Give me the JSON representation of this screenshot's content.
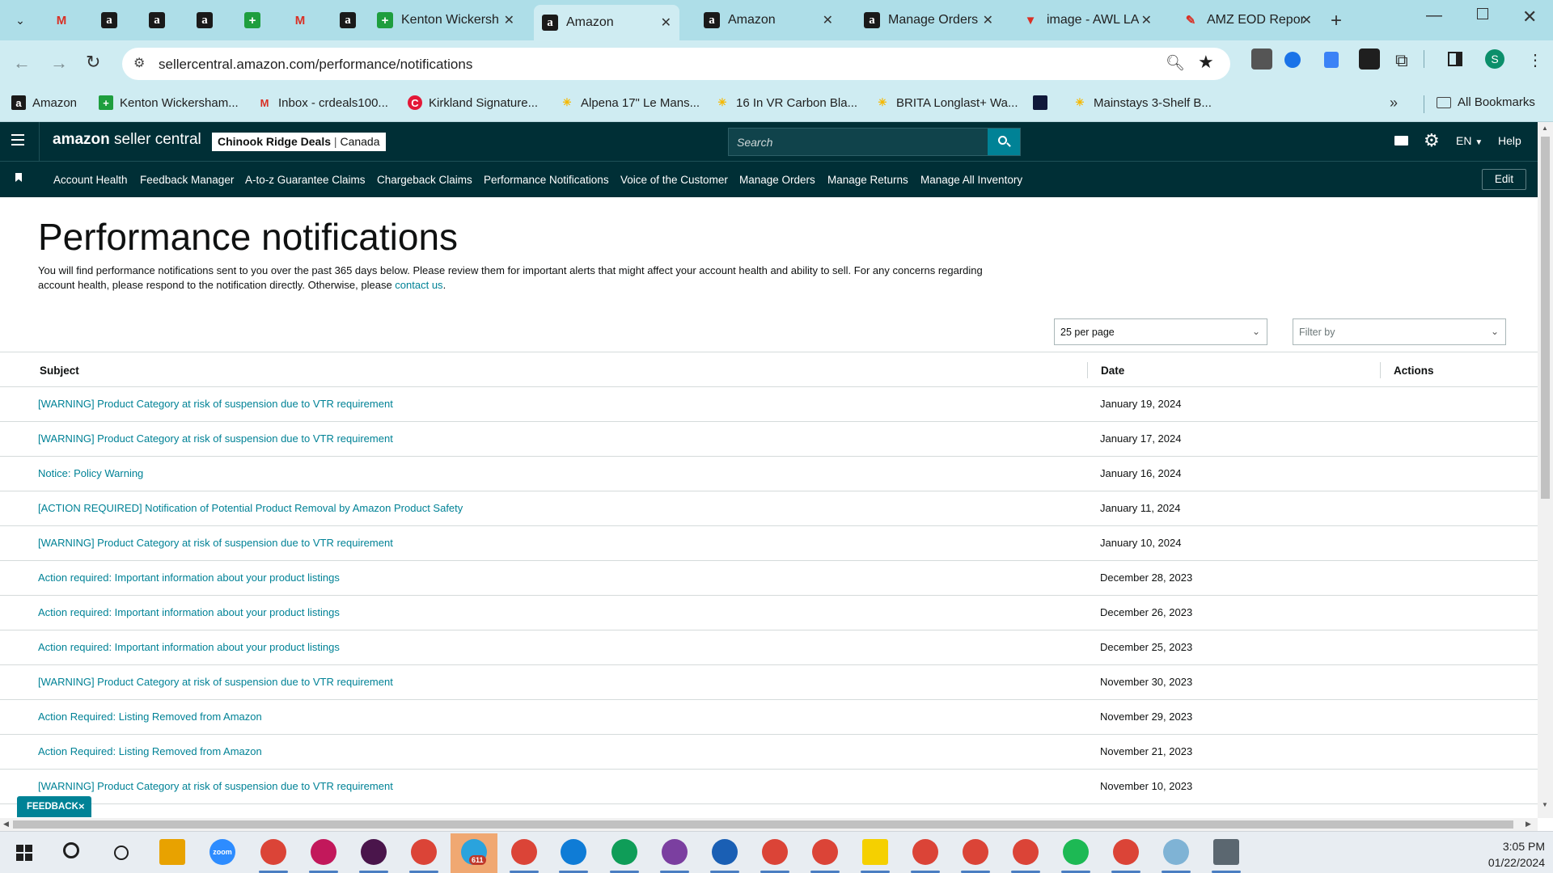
{
  "browser": {
    "tabs": [
      {
        "title": "",
        "icon": "gmail-icon"
      },
      {
        "title": "",
        "icon": "amazon-icon"
      },
      {
        "title": "",
        "icon": "amazon-icon"
      },
      {
        "title": "",
        "icon": "amazon-icon"
      },
      {
        "title": "",
        "icon": "sheets-plus-icon"
      },
      {
        "title": "",
        "icon": "gmail-icon"
      },
      {
        "title": "",
        "icon": "amazon-icon"
      },
      {
        "title": "Kenton Wickersh",
        "icon": "sheets-plus-icon"
      },
      {
        "title": "Amazon",
        "icon": "amazon-icon",
        "active": true
      },
      {
        "title": "Amazon",
        "icon": "amazon-icon"
      },
      {
        "title": "Manage Orders",
        "icon": "amazon-icon"
      },
      {
        "title": "image - AWL LA",
        "icon": "awl-icon"
      },
      {
        "title": "AMZ EOD Repor",
        "icon": "pencil-icon"
      }
    ],
    "url": "sellercentral.amazon.com/performance/notifications",
    "bookmarks": [
      {
        "label": "Amazon"
      },
      {
        "label": "Kenton Wickersham..."
      },
      {
        "label": "Inbox - crdeals100..."
      },
      {
        "label": "Kirkland Signature..."
      },
      {
        "label": "Alpena 17\" Le Mans..."
      },
      {
        "label": "16 In VR Carbon Bla..."
      },
      {
        "label": "BRITA Longlast+ Wa..."
      },
      {
        "label": ""
      },
      {
        "label": "Mainstays 3-Shelf B..."
      }
    ],
    "all_bookmarks": "All Bookmarks",
    "profile_initial": "S"
  },
  "header": {
    "logo_bold": "amazon",
    "logo_rest": " seller central",
    "store_name": "Chinook Ridge Deals",
    "store_region": "Canada",
    "search_placeholder": "Search",
    "language": "EN",
    "help": "Help"
  },
  "nav": {
    "items": [
      "Account Health",
      "Feedback Manager",
      "A-to-z Guarantee Claims",
      "Chargeback Claims",
      "Performance Notifications",
      "Voice of the Customer",
      "Manage Orders",
      "Manage Returns",
      "Manage All Inventory"
    ],
    "edit": "Edit"
  },
  "page": {
    "title": "Performance notifications",
    "description": "You will find performance notifications sent to you over the past 365 days below. Please review them for important alerts that might affect your account health and ability to sell. For any concerns regarding account health, please respond to the notification directly. Otherwise, please ",
    "contact_link": "contact us",
    "description_end": ".",
    "per_page": "25 per page",
    "filter_placeholder": "Filter by"
  },
  "table": {
    "headers": {
      "subject": "Subject",
      "date": "Date",
      "actions": "Actions"
    },
    "rows": [
      {
        "subject": "[WARNING] Product Category at risk of suspension due to VTR requirement",
        "date": "January 19, 2024"
      },
      {
        "subject": "[WARNING] Product Category at risk of suspension due to VTR requirement",
        "date": "January 17, 2024"
      },
      {
        "subject": "Notice: Policy Warning",
        "date": "January 16, 2024"
      },
      {
        "subject": "[ACTION REQUIRED] Notification of Potential Product Removal by Amazon Product Safety",
        "date": "January 11, 2024"
      },
      {
        "subject": "[WARNING] Product Category at risk of suspension due to VTR requirement",
        "date": "January 10, 2024"
      },
      {
        "subject": "Action required: Important information about your product listings",
        "date": "December 28, 2023"
      },
      {
        "subject": "Action required: Important information about your product listings",
        "date": "December 26, 2023"
      },
      {
        "subject": "Action required: Important information about your product listings",
        "date": "December 25, 2023"
      },
      {
        "subject": "[WARNING] Product Category at risk of suspension due to VTR requirement",
        "date": "November 30, 2023"
      },
      {
        "subject": "Action Required: Listing Removed from Amazon",
        "date": "November 29, 2023"
      },
      {
        "subject": "Action Required: Listing Removed from Amazon",
        "date": "November 21, 2023"
      },
      {
        "subject": "[WARNING] Product Category at risk of suspension due to VTR requirement",
        "date": "November 10, 2023"
      }
    ]
  },
  "feedback": {
    "label": "FEEDBACK",
    "close": "×"
  },
  "taskbar": {
    "time": "3:05 PM",
    "date": "01/22/2024",
    "telegram_badge": "611",
    "zoom_label": "zoom"
  },
  "colors": {
    "tabstrip": "#aedee8",
    "header_bg": "#002f36",
    "link": "#008296"
  }
}
